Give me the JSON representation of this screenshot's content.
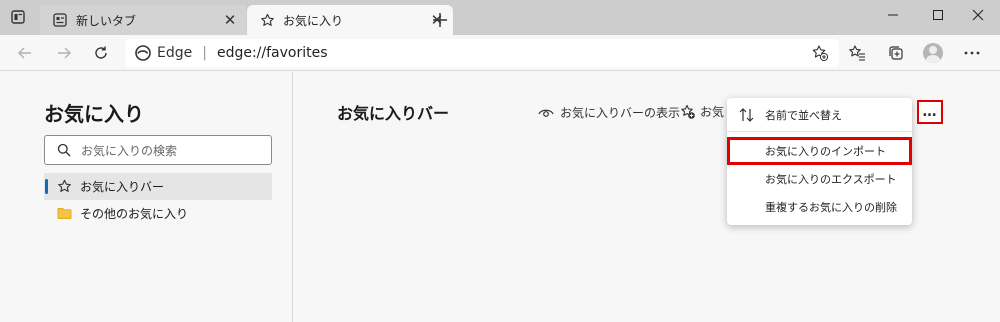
{
  "tabs": [
    {
      "label": "新しいタブ"
    },
    {
      "label": "お気に入り"
    }
  ],
  "address": {
    "site": "Edge",
    "separator": "|",
    "url": "edge://favorites"
  },
  "sidebar": {
    "title": "お気に入り",
    "search_placeholder": "お気に入りの検索",
    "items": [
      {
        "label": "お気に入りバー"
      },
      {
        "label": "その他のお気に入り"
      }
    ]
  },
  "main": {
    "title": "お気に入りバー",
    "show_bar_label": "お気に入りバーの表示",
    "add_label": "お気",
    "more_label": "…"
  },
  "menu": {
    "items": [
      {
        "label": "名前で並べ替え"
      },
      {
        "label": "お気に入りのインポート"
      },
      {
        "label": "お気に入りのエクスポート"
      },
      {
        "label": "重複するお気に入りの削除"
      }
    ]
  },
  "colors": {
    "accent": "#0f6cbd",
    "highlight": "#e00000",
    "folder": "#f5c242"
  }
}
